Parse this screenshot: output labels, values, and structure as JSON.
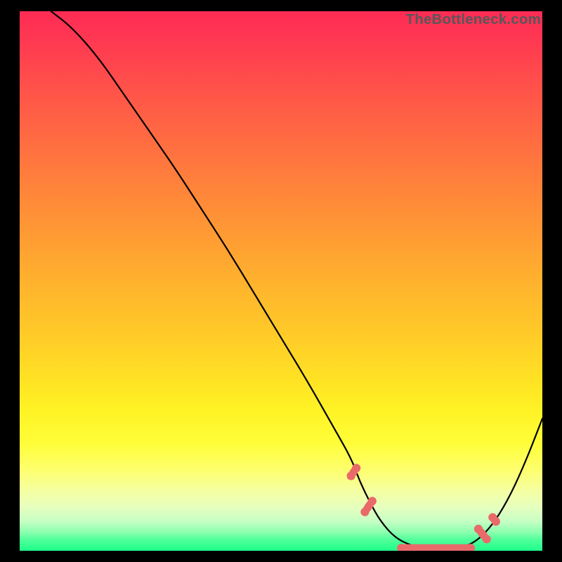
{
  "watermark": "TheBottleneck.com",
  "chart_data": {
    "type": "line",
    "title": "",
    "xlabel": "",
    "ylabel": "",
    "xlim": [
      0,
      100
    ],
    "ylim": [
      0,
      100
    ],
    "grid": false,
    "legend": false,
    "series": [
      {
        "name": "bottleneck-curve",
        "x": [
          6,
          10,
          15,
          20,
          25,
          30,
          35,
          40,
          45,
          50,
          55,
          60,
          63.5,
          65,
          67,
          69,
          72,
          76,
          80,
          83,
          85,
          88,
          91,
          94,
          97,
          100
        ],
        "y": [
          100,
          97,
          91.5,
          84.5,
          77.5,
          70.5,
          63,
          55.5,
          47.5,
          39.5,
          31.5,
          23,
          17,
          13,
          9,
          5.5,
          2.2,
          0.6,
          0.2,
          0.2,
          0.6,
          2.2,
          5.5,
          10.5,
          17,
          24.5
        ]
      }
    ],
    "markers": [
      {
        "name": "zone-1",
        "x_start": 63.0,
        "x_end": 64.8,
        "y": 14.6,
        "angle": -56
      },
      {
        "name": "zone-2",
        "x_start": 65.5,
        "x_end": 68.0,
        "y": 8.2,
        "angle": -56
      },
      {
        "name": "flat-zone",
        "x_start": 73.0,
        "x_end": 86.3,
        "y": 0.5,
        "angle": 0
      },
      {
        "name": "zone-3",
        "x_start": 87.3,
        "x_end": 89.8,
        "y": 3.1,
        "angle": 51
      },
      {
        "name": "zone-4",
        "x_start": 90.3,
        "x_end": 91.3,
        "y": 5.8,
        "angle": 52
      }
    ],
    "colors": {
      "gradient_top": "#ff2b54",
      "gradient_bottom": "#1eff8b",
      "curve": "#000000",
      "marker": "#ea6a6a",
      "background": "#000000"
    }
  }
}
